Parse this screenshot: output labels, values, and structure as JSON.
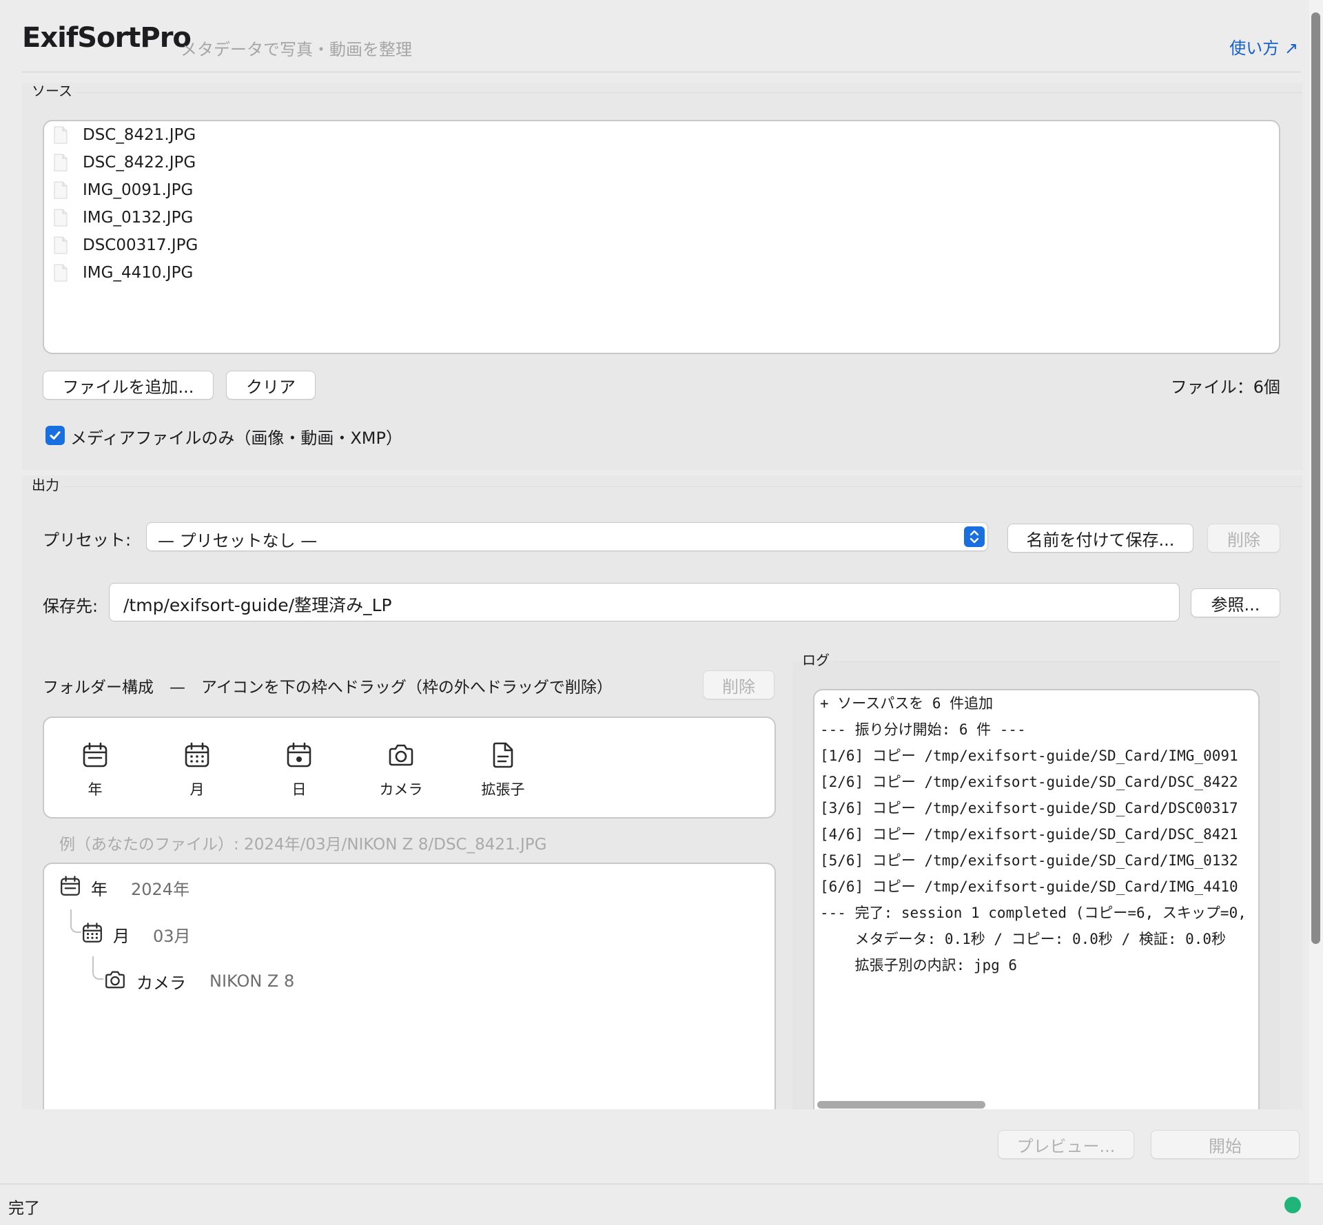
{
  "header": {
    "app_title": "ExifSortPro",
    "subtitle": "メタデータで写真・動画を整理",
    "help_link": "使い方 ↗"
  },
  "source": {
    "group_label": "ソース",
    "files": [
      "DSC_8421.JPG",
      "DSC_8422.JPG",
      "IMG_0091.JPG",
      "IMG_0132.JPG",
      "DSC00317.JPG",
      "IMG_4410.JPG"
    ],
    "add_button": "ファイルを追加...",
    "clear_button": "クリア",
    "file_count": "ファイル：6個",
    "media_only_label": "メディアファイルのみ（画像・動画・XMP）",
    "media_only_checked": true
  },
  "output": {
    "group_label": "出力",
    "preset_label": "プリセット:",
    "preset_value": "— プリセットなし —",
    "save_as_button": "名前を付けて保存...",
    "delete_preset_button": "削除",
    "dest_label": "保存先:",
    "dest_value": "/tmp/exifsort-guide/整理済み_LP",
    "browse_button": "参照..."
  },
  "folder": {
    "title": "フォルダー構成　—　アイコンを下の枠へドラッグ（枠の外へドラッグで削除）",
    "delete_button": "削除",
    "tokens": [
      {
        "icon": "calendar-year-icon",
        "label": "年"
      },
      {
        "icon": "calendar-month-icon",
        "label": "月"
      },
      {
        "icon": "calendar-day-icon",
        "label": "日"
      },
      {
        "icon": "camera-icon",
        "label": "カメラ"
      },
      {
        "icon": "document-icon",
        "label": "拡張子"
      }
    ],
    "example": "例（あなたのファイル）: 2024年/03月/NIKON Z 8/DSC_8421.JPG",
    "tree": [
      {
        "icon": "calendar-year-icon",
        "label": "年",
        "value": "2024年"
      },
      {
        "icon": "calendar-month-icon",
        "label": "月",
        "value": "03月"
      },
      {
        "icon": "camera-icon",
        "label": "カメラ",
        "value": "NIKON Z 8"
      }
    ]
  },
  "log": {
    "group_label": "ログ",
    "lines": [
      "+ ソースパスを 6 件追加",
      "--- 振り分け開始: 6 件 ---",
      "[1/6] コピー /tmp/exifsort-guide/SD_Card/IMG_0091",
      "[2/6] コピー /tmp/exifsort-guide/SD_Card/DSC_8422",
      "[3/6] コピー /tmp/exifsort-guide/SD_Card/DSC00317",
      "[4/6] コピー /tmp/exifsort-guide/SD_Card/DSC_8421",
      "[5/6] コピー /tmp/exifsort-guide/SD_Card/IMG_0132",
      "[6/6] コピー /tmp/exifsort-guide/SD_Card/IMG_4410",
      "--- 完了: session 1 completed (コピー=6, スキップ=0,",
      "    メタデータ: 0.1秒 / コピー: 0.0秒 / 検証: 0.0秒",
      "    拡張子別の内訳: jpg 6"
    ]
  },
  "actions": {
    "preview_button": "プレビュー...",
    "start_button": "開始"
  },
  "status": {
    "text": "完了",
    "indicator_color": "#1fb57a"
  },
  "colors": {
    "accent": "#1a6fe0",
    "link": "#1560c9"
  }
}
